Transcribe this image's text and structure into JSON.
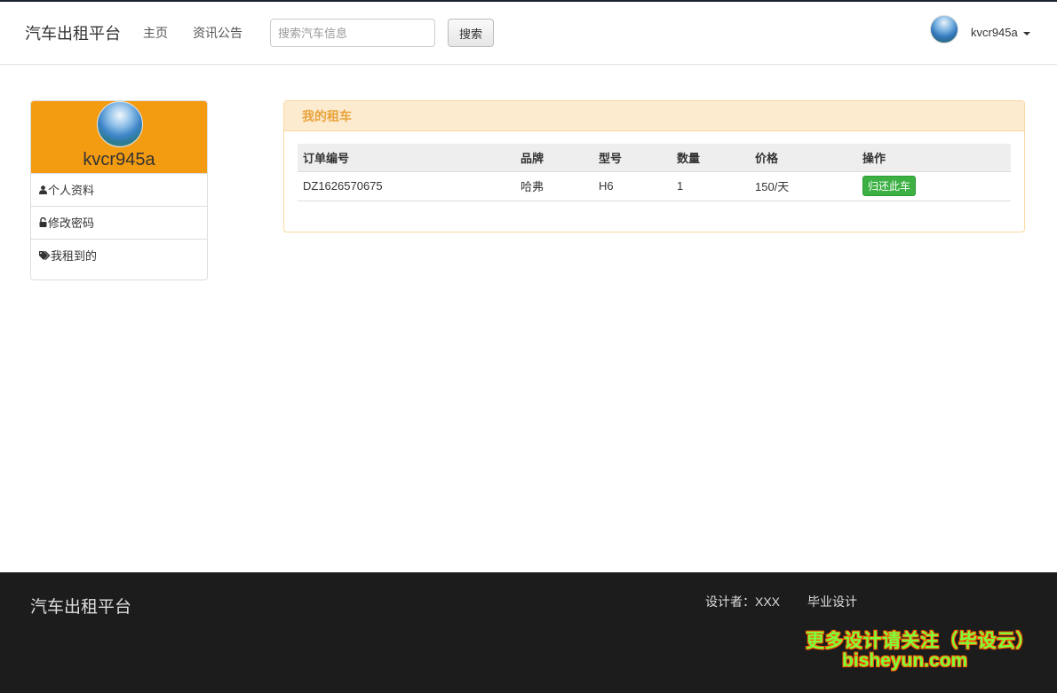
{
  "navbar": {
    "brand": "汽车出租平台",
    "links": [
      "主页",
      "资讯公告"
    ],
    "search_placeholder": "搜索汽车信息",
    "search_button": "搜索",
    "username": "kvcr945a"
  },
  "sidebar": {
    "username": "kvcr945a",
    "items": [
      {
        "icon": "user-icon",
        "label": "个人资料"
      },
      {
        "icon": "lock-icon",
        "label": "修改密码"
      },
      {
        "icon": "tags-icon",
        "label": "我租到的"
      }
    ]
  },
  "main": {
    "panel_title": "我的租车",
    "table": {
      "headers": [
        "订单编号",
        "品牌",
        "型号",
        "数量",
        "价格",
        "操作"
      ],
      "rows": [
        {
          "order_no": "DZ1626570675",
          "brand": "哈弗",
          "model": "H6",
          "quantity": "1",
          "price": "150/天",
          "action": "归还此车"
        }
      ]
    }
  },
  "footer": {
    "brand": "汽车出租平台",
    "designer": "设计者：XXX",
    "link": "毕业设计",
    "watermark_line1": "更多设计请关注（毕设云）",
    "watermark_line2": "bisheyun.com"
  },
  "colors": {
    "profile_header": "#f39c12",
    "panel_header_bg": "#fdebd0",
    "panel_title": "#e8a33a",
    "return_button": "#3cb043",
    "footer_bg": "#1c1c1c"
  }
}
